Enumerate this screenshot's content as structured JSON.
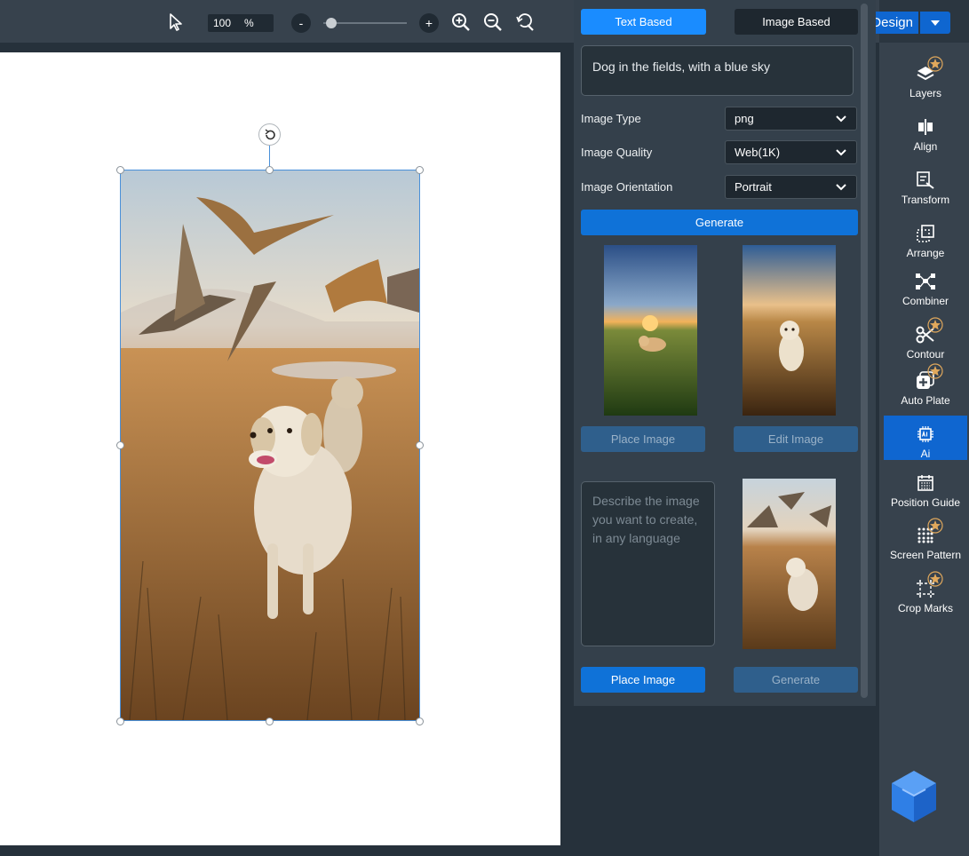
{
  "toolbar": {
    "zoom_value": "100",
    "zoom_unit": "%",
    "zoom_minus": "-",
    "zoom_plus": "+",
    "zoom_level": 0.1,
    "design_label": "Design"
  },
  "ai_panel": {
    "tabs": [
      {
        "label": "Text Based",
        "active": true
      },
      {
        "label": "Image Based",
        "active": false
      }
    ],
    "prompt_text": "Dog in the fields, with a blue sky",
    "fields": [
      {
        "label": "Image Type",
        "value": "png"
      },
      {
        "label": "Image Quality",
        "value": "Web(1K)"
      },
      {
        "label": "Image Orientation",
        "value": "Portrait"
      }
    ],
    "generate_label": "Generate",
    "place_image_label": "Place Image",
    "edit_image_label": "Edit Image",
    "describe_placeholder": "Describe the image you want to create, in any language",
    "place_image_label_2": "Place Image",
    "generate_label_2": "Generate"
  },
  "rightbar": {
    "items": [
      {
        "label": "Layers",
        "icon": "layers-icon",
        "premium": true
      },
      {
        "label": "Align",
        "icon": "align-icon",
        "premium": false
      },
      {
        "label": "Transform",
        "icon": "transform-icon",
        "premium": false
      },
      {
        "label": "Arrange",
        "icon": "arrange-icon",
        "premium": false
      },
      {
        "label": "Combiner",
        "icon": "combiner-icon",
        "premium": false
      },
      {
        "label": "Contour",
        "icon": "scissors-icon",
        "premium": true
      },
      {
        "label": "Auto Plate",
        "icon": "auto-plate-icon",
        "premium": true
      },
      {
        "label": "Ai",
        "icon": "ai-chip-icon",
        "premium": false,
        "active": true
      },
      {
        "label": "Position Guide",
        "icon": "position-guide-icon",
        "premium": false
      },
      {
        "label": "Screen Pattern",
        "icon": "screen-pattern-icon",
        "premium": true
      },
      {
        "label": "Crop Marks",
        "icon": "crop-marks-icon",
        "premium": true
      }
    ]
  },
  "colors": {
    "accent": "#0f72d8",
    "panel": "#34404b",
    "toolbar": "#37424d",
    "premium_star": "#e0a85c"
  }
}
